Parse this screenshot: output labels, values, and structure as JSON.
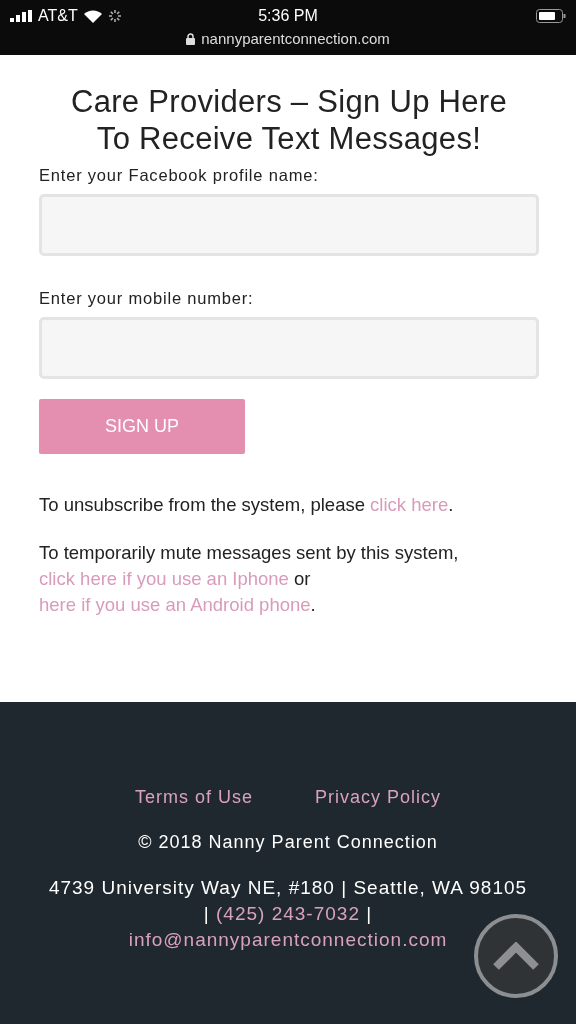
{
  "status_bar": {
    "carrier": "AT&T",
    "time": "5:36 PM",
    "url": "nannyparentconnection.com"
  },
  "form": {
    "title": "Care Providers – Sign Up Here To Receive Text Messages!",
    "fields": [
      {
        "label": "Enter your Facebook profile name:"
      },
      {
        "label": "Enter your mobile number:"
      }
    ],
    "button": "SIGN UP",
    "paragraphs": [
      [
        {
          "kind": "text",
          "text": "To unsubscribe from the system, please "
        },
        {
          "kind": "link",
          "text": "click here"
        },
        {
          "kind": "text",
          "text": "."
        }
      ],
      [
        {
          "kind": "text",
          "text": "To temporarily mute messages sent by this system, "
        },
        {
          "kind": "link",
          "text": "click here if you use an Iphone"
        },
        {
          "kind": "text",
          "text": " or "
        },
        {
          "kind": "link",
          "text": "here if you use an Android phone"
        },
        {
          "kind": "text",
          "text": "."
        }
      ]
    ]
  },
  "footer": {
    "links": [
      "Terms of Use",
      "Privacy Policy"
    ],
    "copyright": "© 2018 Nanny Parent Connection",
    "address": [
      {
        "kind": "text",
        "text": "4739 University Way NE, #180 | Seattle, WA 98105 | "
      },
      {
        "kind": "link",
        "text": "(425) 243-7032"
      },
      {
        "kind": "text",
        "text": "  | "
      },
      {
        "kind": "link",
        "text": "info@nannyparentconnection.com"
      }
    ]
  }
}
